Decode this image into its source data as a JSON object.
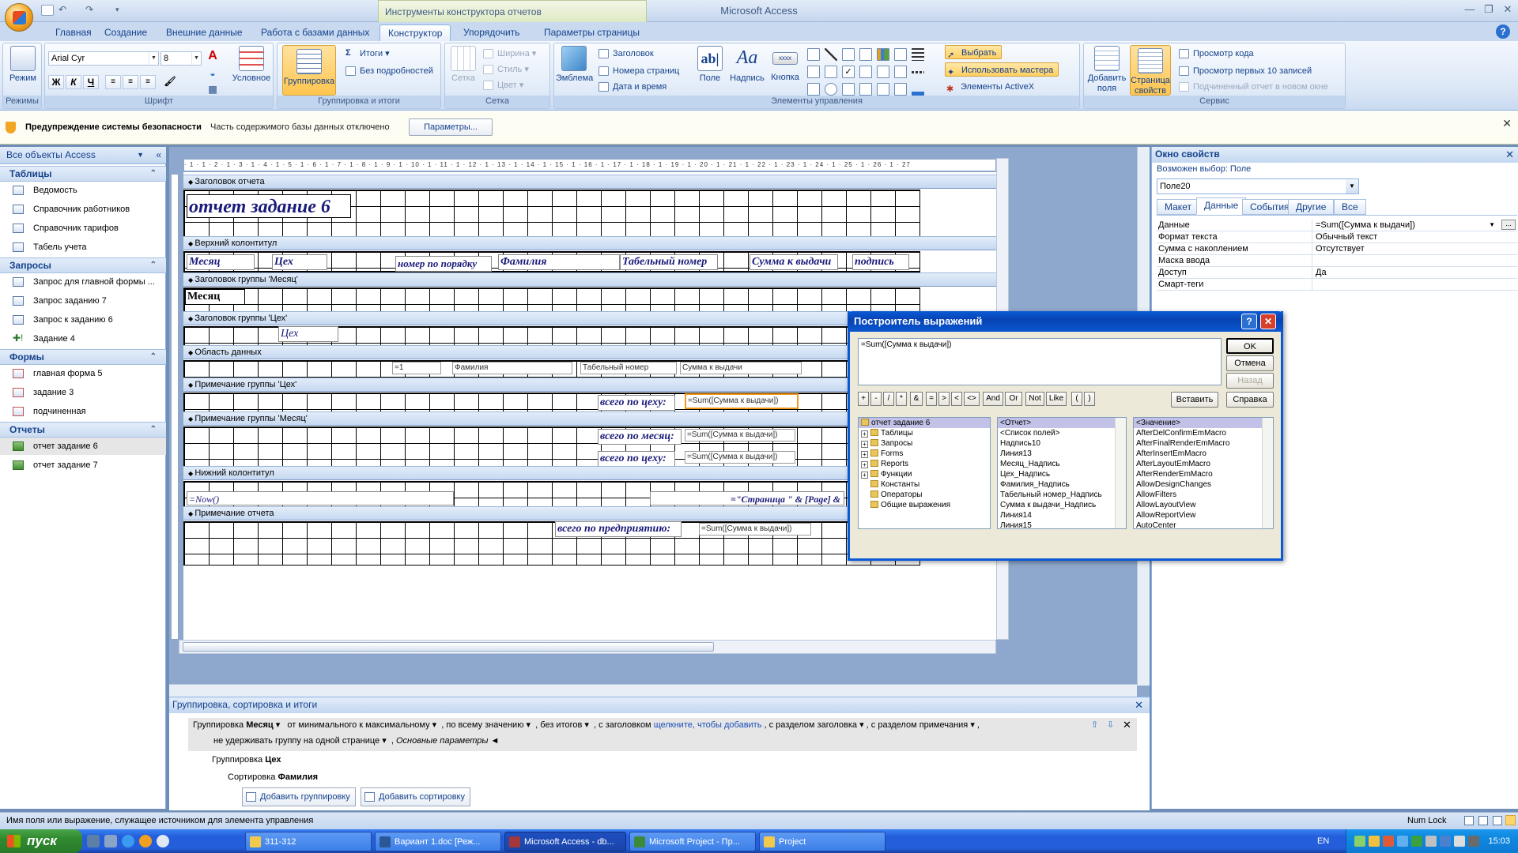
{
  "app": {
    "title": "Microsoft Access",
    "contextual_tools": "Инструменты конструктора отчетов"
  },
  "tabs": [
    "Главная",
    "Создание",
    "Внешние данные",
    "Работа с базами данных",
    "Конструктор",
    "Упорядочить",
    "Параметры страницы"
  ],
  "ribbon": {
    "groups": {
      "views": "Режимы",
      "font": "Шрифт",
      "grouping": "Группировка и итоги",
      "grid": "Сетка",
      "controls": "Элементы управления",
      "tools": "Сервис"
    },
    "view_btn": "Режим",
    "font_name": "Arial Cyr",
    "font_size": "8",
    "conditional": "Условное",
    "grouping_btn": "Группировка",
    "totals": "Итоги",
    "no_details": "Без подробностей",
    "gridlines": "Сетка",
    "width": "Ширина",
    "style": "Стиль",
    "color": "Цвет",
    "logo": "Эмблема",
    "title_btn": "Заголовок",
    "page_numbers": "Номера страниц",
    "date_time": "Дата и время",
    "field": "Поле",
    "label": "Надпись",
    "button": "Кнопка",
    "select": "Выбрать",
    "use_wizard": "Использовать мастера",
    "activex": "Элементы ActiveX",
    "add_fields": "Добавить поля",
    "property_sheet": "Страница свойств",
    "view_code": "Просмотр кода",
    "view_top10": "Просмотр первых 10 записей",
    "subreport": "Подчиненный отчет в новом окне"
  },
  "security": {
    "title": "Предупреждение системы безопасности",
    "text": "Часть содержимого базы данных отключено",
    "button": "Параметры..."
  },
  "nav": {
    "header": "Все объекты Access",
    "sections": [
      {
        "title": "Таблицы",
        "items": [
          "Ведомость",
          "Справочник работников",
          "Справочник тарифов",
          "Табель учета"
        ]
      },
      {
        "title": "Запросы",
        "items": [
          "Запрос для главной формы ...",
          "Запрос заданию 7",
          "Запрос к заданию 6",
          "Задание 4"
        ]
      },
      {
        "title": "Формы",
        "items": [
          "главная форма 5",
          "задание 3",
          "подчиненная"
        ]
      },
      {
        "title": "Отчеты",
        "items": [
          "отчет задание 6",
          "отчет задание 7"
        ]
      }
    ]
  },
  "report": {
    "bands": [
      "Заголовок отчета",
      "Верхний колонтитул",
      "Заголовок группы 'Месяц'",
      "Заголовок группы 'Цех'",
      "Область данных",
      "Примечание группы 'Цех'",
      "Примечание группы 'Месяц'",
      "Нижний колонтитул",
      "Примечание отчета"
    ],
    "title": "отчет задание 6",
    "header_labels": [
      "Месяц",
      "Цех",
      "номер по порядку",
      "Фамилия",
      "Табельный номер",
      "Сумма к выдачи",
      "подпись"
    ],
    "month_field": "Месяц",
    "cex_field": "Цех",
    "detail": [
      "=1",
      "Фамилия",
      "Табельный номер",
      "Сумма к выдачи"
    ],
    "cex_total_label": "всего по цеху:",
    "cex_total_expr": "=Sum([Сумма к выдачи])",
    "month_total_label": "всего по месяц:",
    "month_total_label2": "всего по цеху:",
    "month_total_expr": "=Sum([Сумма к выдачи])",
    "footer_now": "=Now()",
    "footer_page": "=\"Страница \" & [Page] &",
    "report_total_label": "всего по предприятию:",
    "report_total_expr": "=Sum([Сумма к выдачи])",
    "ruler": "· 1 · 1 · 2 · 1 · 3 · 1 · 4 · 1 · 5 · 1 · 6 · 1 · 7 · 1 · 8 · 1 · 9 · 1 · 10 · 1 · 11 · 1 · 12 · 1 · 13 · 1 · 14 · 1 · 15 · 1 · 16 · 1 · 17 · 1 · 18 · 1 · 19 · 1 · 20 · 1 · 21 · 1 · 22 · 1 · 23 · 1 · 24 · 1 · 25 · 1 · 26 · 1 · 27"
  },
  "props": {
    "title": "Окно свойств",
    "selection_label": "Возможен выбор: Поле",
    "selected": "Поле20",
    "tabs": [
      "Макет",
      "Данные",
      "События",
      "Другие",
      "Все"
    ],
    "rows": [
      {
        "name": "Данные",
        "value": "=Sum([Сумма к выдачи])"
      },
      {
        "name": "Формат текста",
        "value": "Обычный текст"
      },
      {
        "name": "Сумма с накоплением",
        "value": "Отсутствует"
      },
      {
        "name": "Маска ввода",
        "value": ""
      },
      {
        "name": "Доступ",
        "value": "Да"
      },
      {
        "name": "Смарт-теги",
        "value": ""
      }
    ]
  },
  "dialog": {
    "title": "Построитель выражений",
    "expression": "=Sum([Сумма к выдачи])",
    "ok": "OK",
    "cancel": "Отмена",
    "back": "Назад",
    "insert": "Вставить",
    "help": "Справка",
    "operators": [
      "+",
      "-",
      "/",
      "*",
      "&",
      "=",
      ">",
      "<",
      "<>",
      "And",
      "Or",
      "Not",
      "Like",
      "(",
      ")"
    ],
    "list1": [
      "отчет задание 6",
      "Таблицы",
      "Запросы",
      "Forms",
      "Reports",
      "Функции",
      "Константы",
      "Операторы",
      "Общие выражения"
    ],
    "list2": [
      "<Отчет>",
      "<Список полей>",
      "Надпись10",
      "Линия13",
      "Месяц_Надпись",
      "Цех_Надпись",
      "Фамилия_Надпись",
      "Табельный номер_Надпись",
      "Сумма к выдачи_Надпись",
      "Линия14",
      "Линия15"
    ],
    "list3": [
      "<Значение>",
      "AfterDelConfirmEmMacro",
      "AfterFinalRenderEmMacro",
      "AfterInsertEmMacro",
      "AfterLayoutEmMacro",
      "AfterRenderEmMacro",
      "AllowDesignChanges",
      "AllowFilters",
      "AllowLayoutView",
      "AllowReportView",
      "AutoCenter"
    ]
  },
  "grouping": {
    "title": "Группировка, сортировка и итоги",
    "row1_prefix": "Группировка",
    "row1_field": "Месяц",
    "row1_opts": [
      "от минимального к максимальному",
      "по всему значению",
      "без итогов",
      "с заголовком",
      "щелкните, чтобы добавить",
      "с разделом заголовка",
      "с разделом примечания"
    ],
    "row1_line2": "не удерживать группу на одной странице",
    "row1_main": "Основные параметры ◄",
    "row2_prefix": "Группировка",
    "row2_field": "Цех",
    "row3_prefix": "Сортировка",
    "row3_field": "Фамилия",
    "add_group": "Добавить группировку",
    "add_sort": "Добавить сортировку"
  },
  "status": {
    "text": "Имя поля или выражение, служащее источником для элемента управления",
    "numlock": "Num Lock"
  },
  "taskbar": {
    "start": "пуск",
    "tasks": [
      "311-312",
      "Вариант 1.doc [Реж...",
      "Microsoft Access - db...",
      "Microsoft Project - Пр...",
      "Project"
    ],
    "lang": "EN",
    "time": "15:03"
  }
}
